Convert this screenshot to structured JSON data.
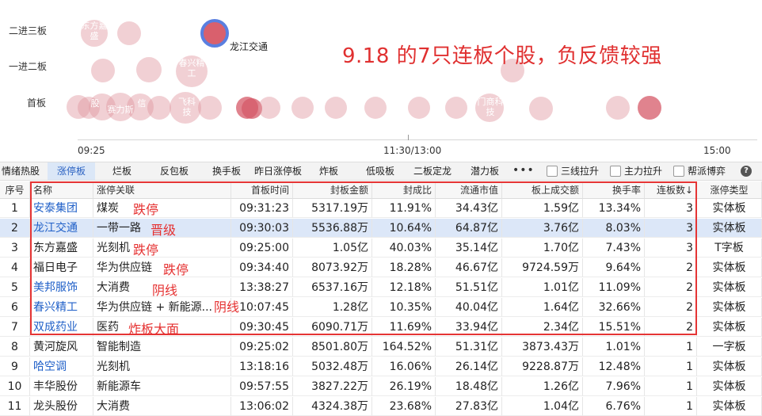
{
  "chart": {
    "row_labels": [
      "二进三板",
      "一进二板",
      "首板"
    ],
    "bubble_texts": [
      {
        "text": "东方嘉\n盛"
      },
      {
        "text": "春兴精\n工"
      },
      {
        "text": "股"
      },
      {
        "text": "赛力斯"
      },
      {
        "text": "信"
      },
      {
        "text": "飞科\n技"
      },
      {
        "text": "门商科\n技"
      }
    ],
    "highlight_name": "龙江交通",
    "time_labels": [
      "09:25",
      "11:30/13:00",
      "15:00"
    ],
    "annotation": "9.18 的7只连板个股，负反馈较强"
  },
  "tabs": [
    "情绪热股",
    "涨停板",
    "烂板",
    "反包板",
    "换手板",
    "昨日涨停板",
    "炸板",
    "低吸板",
    "二板定龙",
    "潜力板"
  ],
  "active_tab": "涨停板",
  "more": "•••",
  "checkboxes": [
    "三线拉升",
    "主力拉升",
    "帮派博弈"
  ],
  "help": "?",
  "table": {
    "headers": [
      "序号",
      "名称",
      "涨停关联",
      "首板时间",
      "封板金额",
      "封成比",
      "流通市值",
      "板上成交额",
      "换手率",
      "连板数↓",
      "涨停类型"
    ],
    "rows": [
      [
        "1",
        "安泰集团",
        "煤炭",
        "09:31:23",
        "5317.19万",
        "11.91%",
        "34.43亿",
        "1.59亿",
        "13.34%",
        "3",
        "实体板"
      ],
      [
        "2",
        "龙江交通",
        "一带一路",
        "09:30:03",
        "5536.88万",
        "10.64%",
        "64.87亿",
        "3.76亿",
        "8.03%",
        "3",
        "实体板"
      ],
      [
        "3",
        "东方嘉盛",
        "光刻机",
        "09:25:00",
        "1.05亿",
        "40.03%",
        "35.14亿",
        "1.70亿",
        "7.43%",
        "3",
        "T字板"
      ],
      [
        "4",
        "福日电子",
        "华为供应链",
        "09:34:40",
        "8073.92万",
        "18.28%",
        "46.67亿",
        "9724.59万",
        "9.64%",
        "2",
        "实体板"
      ],
      [
        "5",
        "美邦服饰",
        "大消费",
        "13:38:27",
        "6537.16万",
        "12.18%",
        "51.51亿",
        "1.01亿",
        "11.09%",
        "2",
        "实体板"
      ],
      [
        "6",
        "春兴精工",
        "华为供应链 + 新能源...",
        "10:07:45",
        "1.28亿",
        "10.35%",
        "40.04亿",
        "1.64亿",
        "32.66%",
        "2",
        "实体板"
      ],
      [
        "7",
        "双成药业",
        "医药",
        "09:30:45",
        "6090.71万",
        "11.69%",
        "33.94亿",
        "2.34亿",
        "15.51%",
        "2",
        "实体板"
      ],
      [
        "8",
        "黄河旋风",
        "智能制造",
        "09:25:02",
        "8501.80万",
        "164.52%",
        "51.31亿",
        "3873.43万",
        "1.01%",
        "1",
        "一字板"
      ],
      [
        "9",
        "哈空调",
        "光刻机",
        "13:18:16",
        "5032.48万",
        "16.06%",
        "26.14亿",
        "9228.87万",
        "12.48%",
        "1",
        "实体板"
      ],
      [
        "10",
        "丰华股份",
        "新能源车",
        "09:57:55",
        "3827.22万",
        "26.19%",
        "18.48亿",
        "1.26亿",
        "7.96%",
        "1",
        "实体板"
      ],
      [
        "11",
        "龙头股份",
        "大消费",
        "13:06:02",
        "4324.38万",
        "23.68%",
        "27.83亿",
        "1.04亿",
        "6.76%",
        "1",
        "实体板"
      ]
    ],
    "blue_name_rows": [
      0,
      1,
      4,
      5,
      6,
      8
    ],
    "selected_row": 1
  },
  "notes": [
    "跌停",
    "晋级",
    "跌停",
    "跌停",
    "阴线",
    "阴线",
    "炸板大面"
  ]
}
